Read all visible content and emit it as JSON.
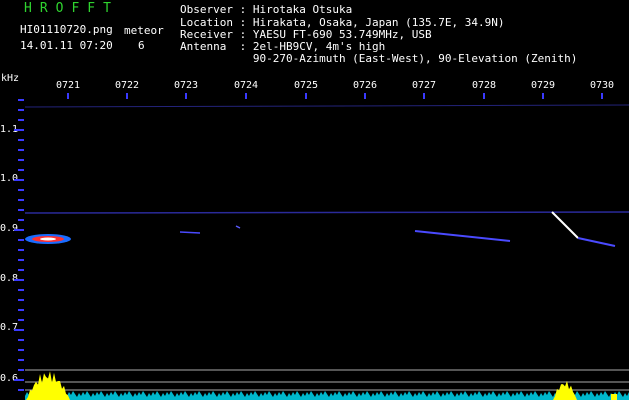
{
  "header": {
    "brand": "HROFFT",
    "filename": "HI01110720.png",
    "timestamp": "14.01.11 07:20",
    "meteor_label": "meteor",
    "meteor_count": "6",
    "observer": "Observer : Hirotaka Otsuka",
    "location": "Location : Hirakata, Osaka, Japan (135.7E, 34.9N)",
    "receiver": "Receiver : YAESU FT-690 53.749MHz, USB",
    "antenna": "Antenna  : 2el-HB9CV, 4m's high",
    "antenna2": "           90-270-Azimuth (East-West), 90-Elevation (Zenith)"
  },
  "axis": {
    "y_unit": "kHz",
    "x_ticks": [
      "0721",
      "0722",
      "0723",
      "0724",
      "0725",
      "0726",
      "0727",
      "0728",
      "0729",
      "0730"
    ],
    "y_ticks": [
      "1.1",
      "1.0",
      "0.9",
      "0.8",
      "0.7",
      "0.6"
    ]
  },
  "colors": {
    "background": "#000000",
    "tick_blue": "#3a3aff",
    "brand_green": "#2fd42f",
    "noise_cyan": "#00e5ff",
    "peak_yellow": "#ffff00"
  }
}
